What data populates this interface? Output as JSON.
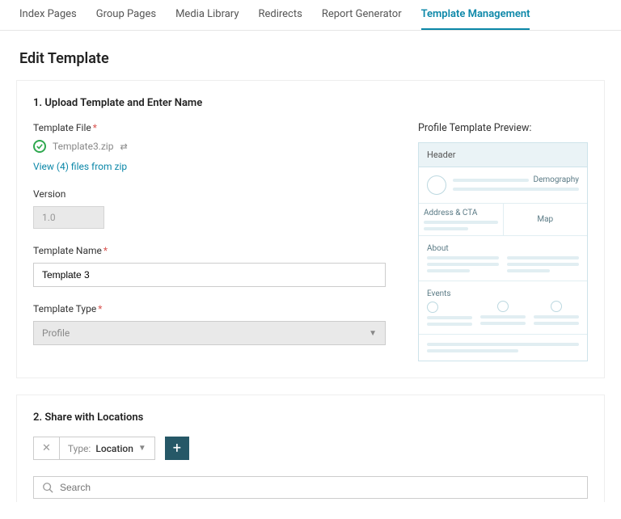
{
  "tabs": [
    {
      "label": "Index Pages"
    },
    {
      "label": "Group Pages"
    },
    {
      "label": "Media Library"
    },
    {
      "label": "Redirects"
    },
    {
      "label": "Report Generator"
    },
    {
      "label": "Template Management"
    }
  ],
  "page_title": "Edit Template",
  "section1": {
    "heading": "1. Upload Template and Enter Name",
    "template_file_label": "Template File",
    "file_name": "Template3.zip",
    "view_files_link": "View (4) files from zip",
    "version_label": "Version",
    "version_value": "1.0",
    "template_name_label": "Template Name",
    "template_name_value": "Template 3",
    "template_type_label": "Template Type",
    "template_type_value": "Profile"
  },
  "preview": {
    "label": "Profile Template Preview:",
    "header": "Header",
    "demography": "Demography",
    "address_cta": "Address & CTA",
    "map": "Map",
    "about": "About",
    "events": "Events"
  },
  "section2": {
    "heading": "2. Share with Locations",
    "filter_type_label": "Type:",
    "filter_type_value": "Location",
    "search_placeholder": "Search"
  }
}
